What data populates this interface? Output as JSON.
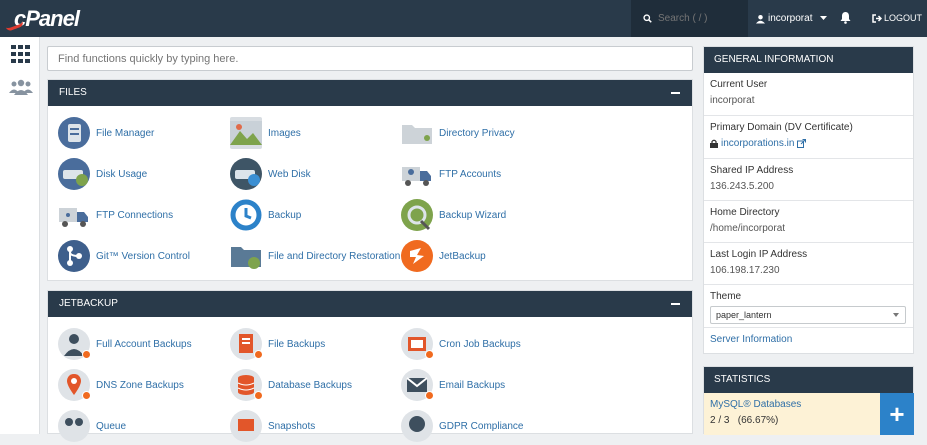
{
  "topbar": {
    "logo_text": "cPanel",
    "search_placeholder": "Search ( / )",
    "username": "incorporat",
    "logout_label": "LOGOUT"
  },
  "main_search_placeholder": "Find functions quickly by typing here.",
  "files": {
    "title": "FILES",
    "items": [
      "File Manager",
      "Images",
      "Directory Privacy",
      "Disk Usage",
      "Web Disk",
      "FTP Accounts",
      "FTP Connections",
      "Backup",
      "Backup Wizard",
      "Git™ Version Control",
      "File and Directory Restoration",
      "JetBackup"
    ]
  },
  "jetbackup": {
    "title": "JETBACKUP",
    "items": [
      "Full Account Backups",
      "File Backups",
      "Cron Job Backups",
      "DNS Zone Backups",
      "Database Backups",
      "Email Backups",
      "Queue",
      "Snapshots",
      "GDPR Compliance"
    ]
  },
  "general_info": {
    "title": "GENERAL INFORMATION",
    "current_user_label": "Current User",
    "current_user": "incorporat",
    "primary_domain_label": "Primary Domain (DV Certificate)",
    "primary_domain": "incorporations.in",
    "shared_ip_label": "Shared IP Address",
    "shared_ip": "136.243.5.200",
    "home_dir_label": "Home Directory",
    "home_dir": "/home/incorporat",
    "last_login_label": "Last Login IP Address",
    "last_login": "106.198.17.230",
    "theme_label": "Theme",
    "theme_value": "paper_lantern",
    "server_info": "Server Information"
  },
  "statistics": {
    "title": "STATISTICS",
    "mysql_label": "MySQL® Databases",
    "mysql_value": "2 / 3   (66.67%)",
    "plus_label": "+"
  },
  "colors": {
    "topbar": "#293a4a",
    "link": "#2f6fa7",
    "accent_orange": "#f06a1f",
    "stats_highlight": "#fdf2d6",
    "plus_blue": "#2c82c9"
  }
}
